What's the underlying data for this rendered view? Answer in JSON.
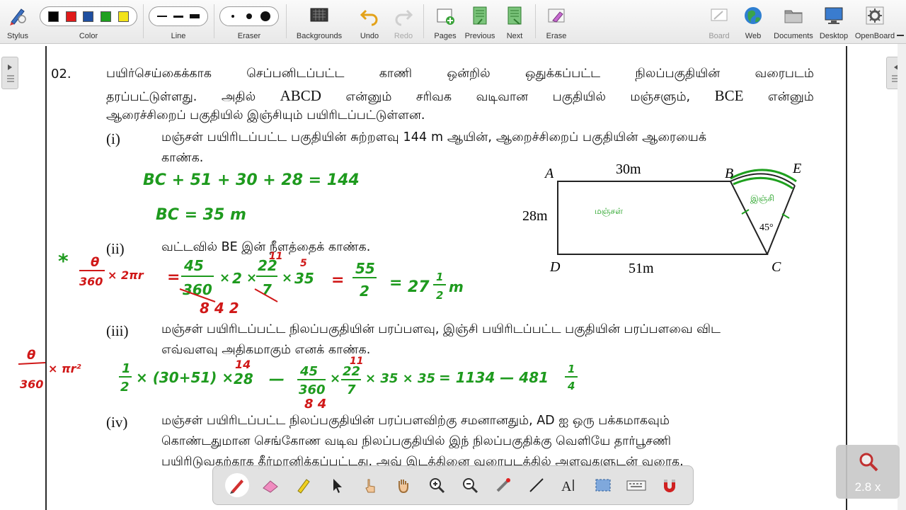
{
  "toolbar": {
    "stylus": "Stylus",
    "color": "Color",
    "line": "Line",
    "eraser": "Eraser",
    "backgrounds": "Backgrounds",
    "undo": "Undo",
    "redo": "Redo",
    "pages": "Pages",
    "previous": "Previous",
    "next": "Next",
    "erase": "Erase",
    "board": "Board",
    "web": "Web",
    "documents": "Documents",
    "desktop": "Desktop",
    "openboard": "OpenBoard",
    "colors": [
      "#000000",
      "#e01b1b",
      "#1f4fa0",
      "#20a020",
      "#f2e31a"
    ]
  },
  "question": {
    "number": "02.",
    "intro_line1": [
      "பயிர்செய்கைக்காக",
      "செப்பனிடப்பட்ட",
      "காணி",
      "ஒன்றில்",
      "ஒதுக்கப்பட்ட",
      "நிலப்பகுதியின்",
      "வரைபடம்"
    ],
    "intro_line2": [
      "தரப்பட்டுள்ளது.",
      "அதில்",
      "ABCD",
      "என்னும்",
      "சரிவக",
      "வடிவான",
      "பகுதியில்",
      "மஞ்சளும்,",
      "BCE",
      "என்னும்"
    ],
    "intro_line3": "ஆரைச்சிறைப் பகுதியில் இஞ்சியும் பயிரிடப்பட்டுள்ளன.",
    "parts": [
      {
        "label": "(i)",
        "line1": "மஞ்சள் பயிரிடப்பட்ட பகுதியின் சுற்றளவு 144 m ஆயின், ஆறைச்சிறைப் பகுதியின் ஆரையைக்",
        "line2": "காண்க."
      },
      {
        "label": "(ii)",
        "line1": "வட்டவில் BE இன் நீளத்தைக் காண்க."
      },
      {
        "label": "(iii)",
        "line1": "மஞ்சள் பயிரிடப்பட்ட நிலப்பகுதியின் பரப்பளவு, இஞ்சி பயிரிடப்பட்ட பகுதியின் பரப்பளவை விட",
        "line2": "எவ்வளவு அதிகமாகும் எனக் காண்க."
      },
      {
        "label": "(iv)",
        "line1": "மஞ்சள் பயிரிடப்பட்ட நிலப்பகுதியின் பரப்பளவிற்கு சமனானதும், AD ஐ ஒரு பக்கமாகவும்",
        "line2": "கொண்டதுமான செங்கோண வடிவ நிலப்பகுதியில் இந் நிலப்பகுதிக்கு வெளியே தார்பூசணி",
        "line3": "பயிரிடுவதற்காக தீர்மானிக்கப்பட்டது. அவ் இடத்தினை வரைபடத்தில் அளவுகளுடன் வரைக."
      }
    ]
  },
  "diagram": {
    "A": "A",
    "B": "B",
    "C": "C",
    "D": "D",
    "E": "E",
    "top": "30m",
    "left": "28m",
    "bottom": "51m",
    "angle": "45°",
    "region_note": "மஞ்சள்",
    "sector_note": "இஞ்சி"
  },
  "handwriting": {
    "i_line1": "BC + 51 + 30 + 28 = 144",
    "i_line2": "BC = 35 m",
    "star": "*",
    "ii_formula_num": "θ",
    "ii_formula_den": "360",
    "ii_formula_rest": "× 2πr",
    "ii_eq": "=",
    "ii_45": "45",
    "ii_360": "360",
    "ii_times1": "×",
    "ii_2": "2",
    "ii_times2": "×",
    "ii_22": "22",
    "ii_11": "11",
    "ii_7": "7",
    "ii_times3": "×",
    "ii_35": "35",
    "ii_5": "5",
    "ii_eq2": "=",
    "ii_55": "55",
    "ii_2b": "2",
    "ii_eq3": "=",
    "ii_27": "27",
    "ii_1": "1",
    "ii_2c": "2",
    "ii_m": "m",
    "ii_842": "8 4 2",
    "iii_formula_num": "θ",
    "iii_formula_den": "360",
    "iii_formula_rest": "× πr²",
    "iii_half_num": "1",
    "iii_half_den": "2",
    "iii_paren": "× (30+51) ×",
    "iii_14": "14",
    "iii_28": "28",
    "iii_minus": "—",
    "iii_45": "45",
    "iii_360": "360",
    "iii_84": "8 4",
    "iii_times": "×",
    "iii_22": "22",
    "iii_11": "11",
    "iii_7": "7",
    "iii_x35": "× 35 × 35",
    "iii_result": "= 1134 — 481",
    "iii_frac_num": "1",
    "iii_frac_den": "4"
  },
  "zoom": {
    "label": "2.8 x"
  }
}
